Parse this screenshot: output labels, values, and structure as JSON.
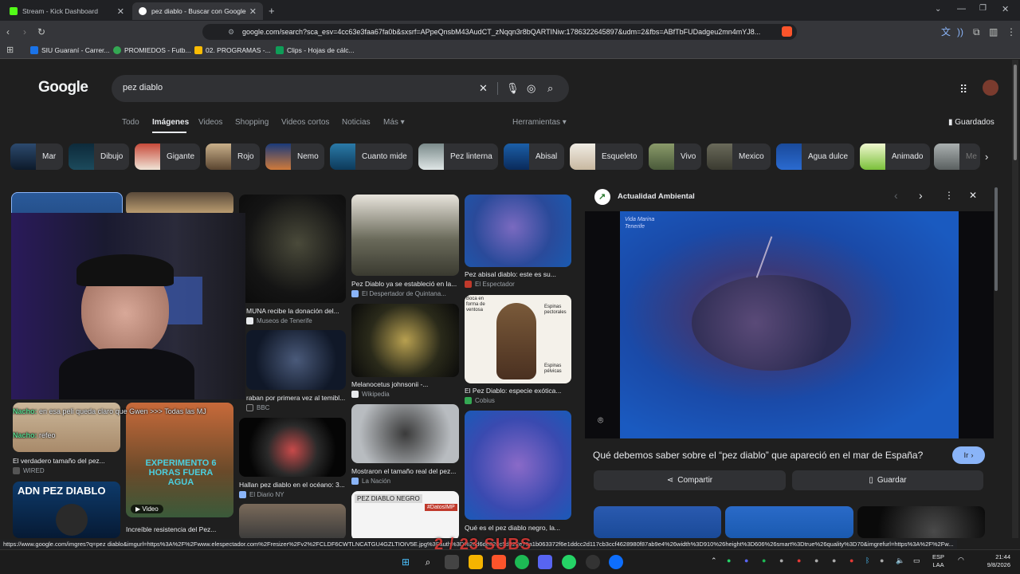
{
  "browser": {
    "tabs": [
      {
        "title": "Stream - Kick Dashboard",
        "active": false
      },
      {
        "title": "pez diablo - Buscar con Google",
        "active": true
      }
    ],
    "url": "google.com/search?sca_esv=4cc63e3faa67fa0b&sxsrf=APpeQnsbM43AudCT_zNqqn3r8bQARTINiw:1786322645897&udm=2&fbs=ABfTbFUDadgeu2mn4mYJ8...",
    "bookmarks": [
      "SIU Guaraní - Carrer...",
      "PROMIEDOS - Futb...",
      "02. PROGRAMAS -...",
      "Clips - Hojas de cálc..."
    ]
  },
  "search": {
    "logo": "Google",
    "query": "pez diablo",
    "nav": [
      "Todo",
      "Imágenes",
      "Videos",
      "Shopping",
      "Videos cortos",
      "Noticias",
      "Más"
    ],
    "tools": "Herramientas",
    "saved": "Guardados",
    "chips": [
      "Mar",
      "Dibujo",
      "Gigante",
      "Rojo",
      "Nemo",
      "Cuanto mide",
      "Pez linterna",
      "Abisal",
      "Esqueleto",
      "Vivo",
      "Mexico",
      "Agua dulce",
      "Animado",
      "Me"
    ]
  },
  "results": [
    {
      "caption": "MUNA recibe la donación del...",
      "source": "Museos de Tenerife"
    },
    {
      "caption": "Pez Diablo ya se estableció en la...",
      "source": "El Despertador de Quintana..."
    },
    {
      "caption": "Pez abisal diablo: este es su...",
      "source": "El Espectador"
    },
    {
      "caption": "raban por primera vez al temibl...",
      "source": "BBC"
    },
    {
      "caption": "Melanocetus johnsonii -...",
      "source": "Wikipedia"
    },
    {
      "caption": "El Pez Diablo: especie exótica...",
      "source": "Cobius"
    },
    {
      "caption": "El verdadero tamaño del pez...",
      "source": "WIRED"
    },
    {
      "caption": "Hallan pez diablo en el océano: 3...",
      "source": "El Diario NY"
    },
    {
      "caption": "Mostraron el tamaño real del pez...",
      "source": "La Nación"
    },
    {
      "caption": "Increíble resistencia del Pez...",
      "source": ""
    },
    {
      "caption": "Qué es el pez diablo negro, la...",
      "source": ""
    }
  ],
  "thumb_texts": {
    "experimento": "EXPERIMENTO 6 HORAS FUERA AGUA",
    "adn": "ADN PEZ DIABLO",
    "video": "Video",
    "negro": "PEZ DIABLO NEGRO",
    "datos": "#DatosIMP",
    "vida_marina": "Vida Marina Tenerife",
    "espinas_pectorales": "Espinas pectorales",
    "espinas_pelvicas": "Espinas pélvicas",
    "boca": "Boca en forma de ventosa"
  },
  "panel": {
    "source": "Actualidad Ambiental",
    "title": "Qué debemos saber sobre el “pez diablo” que apareció en el mar de España?",
    "go": "Ir",
    "share": "Compartir",
    "save": "Guardar"
  },
  "stream_chat": [
    {
      "nick": "Nacho:",
      "text": "en esa peli queda claro que Gwen >>> Todas las MJ"
    },
    {
      "nick": "Nacho:",
      "text": "refeo"
    }
  ],
  "overlay_sub": "2 / 23 SUBS",
  "status_url": "https://www.google.com/imgres?q=pez diablo&imgurl=https%3A%2F%2Fwww.elespectador.com%2Fresizer%2Fv2%2FCLDF6CWTLNCATGU4GZLTIOIV5E.jpg%3Fauth%3D%26d6de820c5d522e79a1b063372f6e1ddcc2d117cb3ccf4628980f87ab9e4%26width%3D910%26height%3D606%26smart%3Dtrue%26quality%3D70&imgrefurl=https%3A%2F%2Fw...",
  "taskbar": {
    "lang": "ESP",
    "lang2": "LAA",
    "time": "21:44",
    "date": "9/8/2026"
  }
}
